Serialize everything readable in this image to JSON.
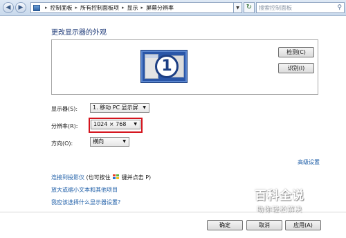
{
  "addressbar": {
    "breadcrumbs": [
      "控制面板",
      "所有控制面板项",
      "显示",
      "屏幕分辨率"
    ],
    "search_placeholder": "搜索控制面板"
  },
  "page": {
    "heading": "更改显示器的外观",
    "monitor_number": "1"
  },
  "buttons": {
    "detect": "检测(C)",
    "identify": "识别(I)",
    "ok": "确定",
    "cancel": "取消",
    "apply": "应用(A)"
  },
  "settings": {
    "display_label": "显示器(S):",
    "display_value": "1. 移动 PC 显示屏",
    "resolution_label": "分辨率(R):",
    "resolution_value": "1024 × 768",
    "orientation_label": "方向(O):",
    "orientation_value": "横向"
  },
  "links": {
    "advanced": "高级设置",
    "projector": "连接到投影仪",
    "projector_hint_prefix": "(也可按住",
    "projector_hint_suffix": "键并点击 P)",
    "text_size": "放大或缩小文本和其他项目",
    "which_setting": "我应该选择什么显示器设置?"
  },
  "watermark": {
    "title": "百科全说",
    "subtitle": "助你轻松解决"
  },
  "colors": {
    "link": "#1f5fa8",
    "heading": "#1e3a78",
    "highlight_box": "#d4141d",
    "monitor": "#2a56a8"
  },
  "icons": [
    "back-icon",
    "forward-icon",
    "control-panel-icon",
    "dropdown-icon",
    "refresh-icon",
    "search-icon",
    "windows-logo-icon"
  ]
}
